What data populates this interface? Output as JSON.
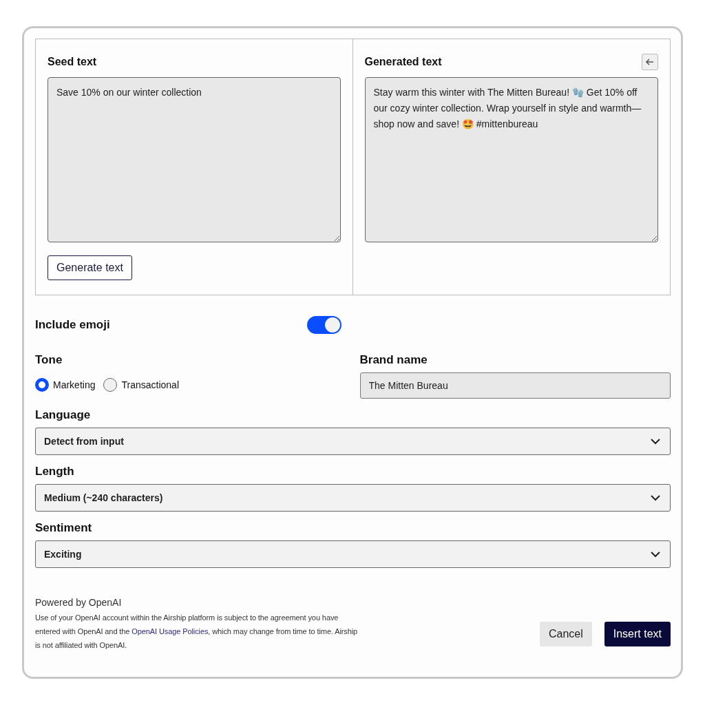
{
  "seed": {
    "label": "Seed text",
    "value": "Save 10% on our winter collection",
    "button": "Generate text"
  },
  "generated": {
    "label": "Generated text",
    "value": "Stay warm this winter with The Mitten Bureau! 🧤 Get 10% off our cozy winter collection. Wrap yourself in style and warmth—shop now and save! 🤩 #mittenbureau"
  },
  "include_emoji": {
    "label": "Include emoji",
    "on": true
  },
  "tone": {
    "label": "Tone",
    "options": [
      {
        "label": "Marketing",
        "selected": true
      },
      {
        "label": "Transactional",
        "selected": false
      }
    ]
  },
  "brand": {
    "label": "Brand name",
    "value": "The Mitten Bureau"
  },
  "selects": [
    {
      "label": "Language",
      "value": "Detect from input"
    },
    {
      "label": "Length",
      "value": "Medium (~240 characters)"
    },
    {
      "label": "Sentiment",
      "value": "Exciting"
    }
  ],
  "footer": {
    "title": "Powered by OpenAI",
    "text_before": "Use of your OpenAI account within the Airship platform is subject to the agreement you have entered with OpenAI and the ",
    "link": "OpenAI Usage Policies",
    "text_after": ", which may change from time to time. Airship is not affiliated with OpenAI."
  },
  "buttons": {
    "cancel": "Cancel",
    "insert": "Insert text"
  }
}
